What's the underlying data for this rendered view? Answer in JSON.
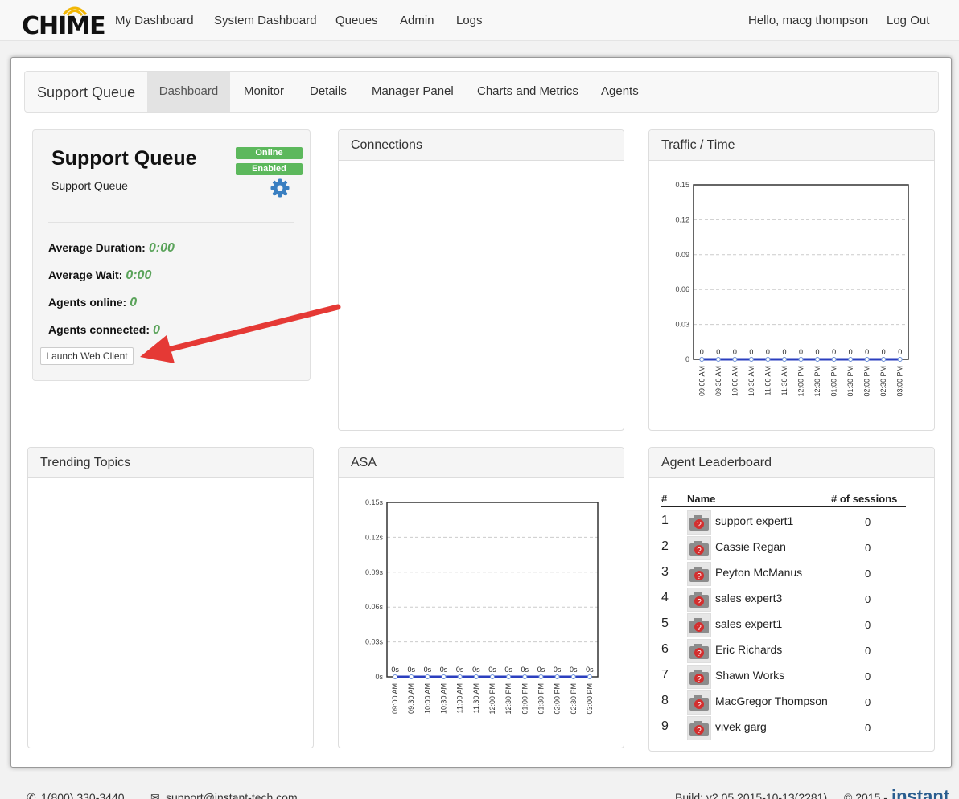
{
  "topnav": {
    "logo": "CHIME",
    "links": [
      "My Dashboard",
      "System Dashboard",
      "Queues",
      "Admin",
      "Logs"
    ],
    "greeting": "Hello, macg thompson",
    "logout": "Log Out"
  },
  "subnav": {
    "brand": "Support Queue",
    "tabs": [
      "Dashboard",
      "Monitor",
      "Details",
      "Manager Panel",
      "Charts and Metrics",
      "Agents"
    ],
    "active_tab": "Dashboard"
  },
  "queue": {
    "title": "Support Queue",
    "subtitle": "Support Queue",
    "status_online": "Online",
    "status_enabled": "Enabled",
    "stats": [
      {
        "label": "Average Duration:",
        "value": "0:00"
      },
      {
        "label": "Average Wait:",
        "value": "0:00"
      },
      {
        "label": "Agents online:",
        "value": "0"
      },
      {
        "label": "Agents connected:",
        "value": "0"
      }
    ],
    "launch_button": "Launch Web Client"
  },
  "panels": {
    "connections": "Connections",
    "traffic": "Traffic / Time",
    "trending": "Trending Topics",
    "asa": "ASA",
    "leaderboard": "Agent Leaderboard"
  },
  "leaderboard": {
    "headers": {
      "rank": "#",
      "name": "Name",
      "sessions": "# of sessions"
    },
    "rows": [
      {
        "rank": "1",
        "name": "support expert1",
        "sessions": "0"
      },
      {
        "rank": "2",
        "name": "Cassie Regan",
        "sessions": "0"
      },
      {
        "rank": "3",
        "name": "Peyton McManus",
        "sessions": "0"
      },
      {
        "rank": "4",
        "name": "sales expert3",
        "sessions": "0"
      },
      {
        "rank": "5",
        "name": "sales expert1",
        "sessions": "0"
      },
      {
        "rank": "6",
        "name": "Eric Richards",
        "sessions": "0"
      },
      {
        "rank": "7",
        "name": "Shawn Works",
        "sessions": "0"
      },
      {
        "rank": "8",
        "name": "MacGregor Thompson",
        "sessions": "0"
      },
      {
        "rank": "9",
        "name": "vivek garg",
        "sessions": "0"
      }
    ]
  },
  "footer": {
    "phone": "1(800) 330-3440",
    "email": "support@instant-tech.com",
    "build": "Build: v2.05 2015-10-13(2281)",
    "copyright": "© 2015 -",
    "brand": "instant"
  },
  "colors": {
    "badge_green": "#5cb85c",
    "stat_green": "#5aa35a",
    "series_blue": "#2b3fbf",
    "gear_blue": "#3a7fc1",
    "arrow_red": "#e53935"
  },
  "chart_data": [
    {
      "id": "traffic",
      "type": "line",
      "x": [
        "09:00 AM",
        "09:30 AM",
        "10:00 AM",
        "10:30 AM",
        "11:00 AM",
        "11:30 AM",
        "12:00 PM",
        "12:30 PM",
        "01:00 PM",
        "01:30 PM",
        "02:00 PM",
        "02:30 PM",
        "03:00 PM"
      ],
      "values": [
        0,
        0,
        0,
        0,
        0,
        0,
        0,
        0,
        0,
        0,
        0,
        0,
        0
      ],
      "data_labels": [
        "0",
        "0",
        "0",
        "0",
        "0",
        "0",
        "0",
        "0",
        "0",
        "0",
        "0",
        "0",
        "0"
      ],
      "yticks": [
        "0",
        "0.03",
        "0.06",
        "0.09",
        "0.12",
        "0.15"
      ],
      "ylim": [
        0,
        0.15
      ],
      "grid": true
    },
    {
      "id": "asa",
      "type": "line",
      "x": [
        "09:00 AM",
        "09:30 AM",
        "10:00 AM",
        "10:30 AM",
        "11:00 AM",
        "11:30 AM",
        "12:00 PM",
        "12:30 PM",
        "01:00 PM",
        "01:30 PM",
        "02:00 PM",
        "02:30 PM",
        "03:00 PM"
      ],
      "values": [
        0,
        0,
        0,
        0,
        0,
        0,
        0,
        0,
        0,
        0,
        0,
        0,
        0
      ],
      "data_labels": [
        "0s",
        "0s",
        "0s",
        "0s",
        "0s",
        "0s",
        "0s",
        "0s",
        "0s",
        "0s",
        "0s",
        "0s",
        "0s"
      ],
      "yticks": [
        "0s",
        "0.03s",
        "0.06s",
        "0.09s",
        "0.12s",
        "0.15s"
      ],
      "ylim": [
        0,
        0.15
      ],
      "grid": true
    }
  ]
}
